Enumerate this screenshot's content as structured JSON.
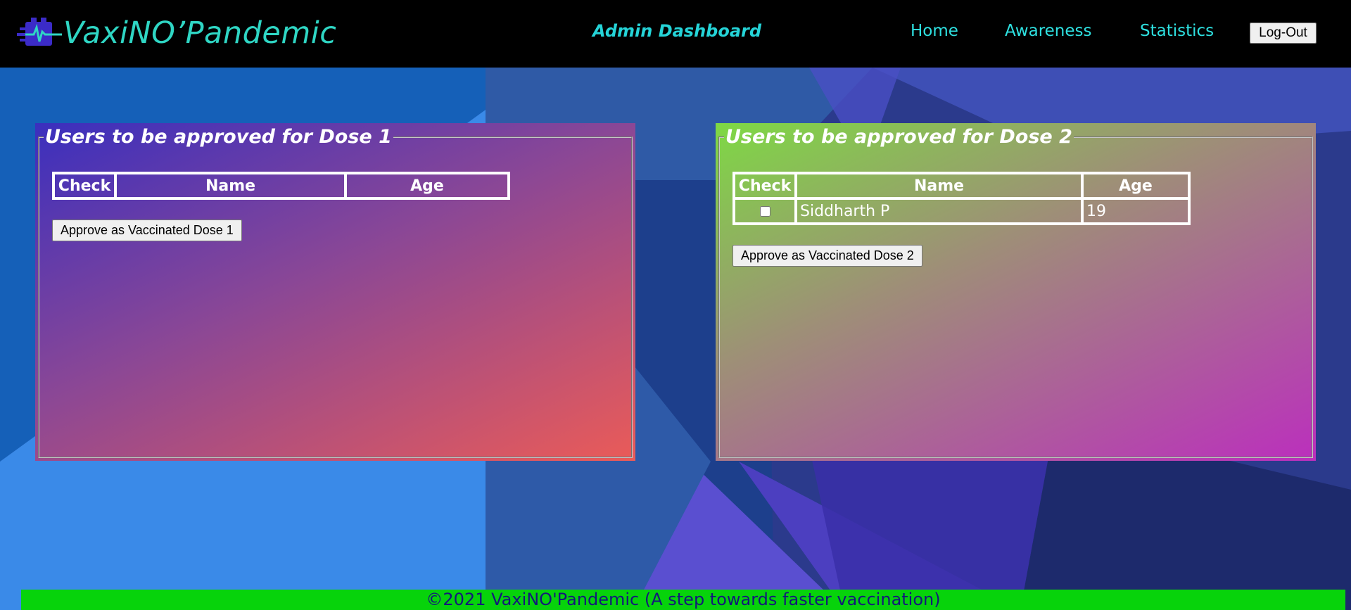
{
  "header": {
    "logo_text": "VaxiNO’Pandemic",
    "page_title": "Admin Dashboard",
    "nav": [
      {
        "label": "Home"
      },
      {
        "label": "Awareness"
      },
      {
        "label": "Statistics"
      }
    ],
    "logout_label": "Log-Out"
  },
  "dose1": {
    "legend": "Users to be approved for Dose 1",
    "columns": [
      "Check",
      "Name",
      "Age"
    ],
    "rows": [],
    "approve_label": "Approve as Vaccinated Dose 1"
  },
  "dose2": {
    "legend": "Users to be approved for Dose 2",
    "columns": [
      "Check",
      "Name",
      "Age"
    ],
    "rows": [
      {
        "checked": false,
        "name": "Siddharth P",
        "age": "19"
      }
    ],
    "approve_label": "Approve as Vaccinated Dose 2"
  },
  "footer": {
    "text": "©2021 VaxiNO'Pandemic (A step towards faster vaccination)"
  },
  "colors": {
    "header_bg": "#000000",
    "accent_cyan": "#2ee0e0",
    "footer_bg": "#07d30b",
    "footer_text": "#14197a"
  }
}
